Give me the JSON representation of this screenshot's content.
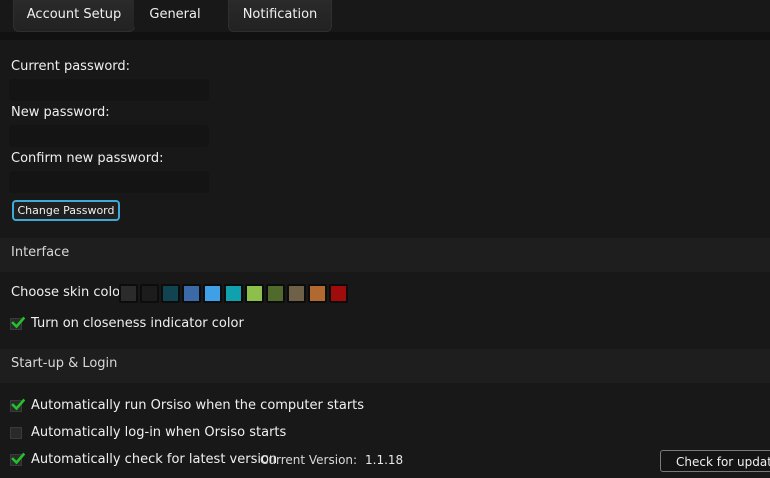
{
  "tabs": [
    {
      "label": "Account Setup",
      "active": false
    },
    {
      "label": "General",
      "active": true
    },
    {
      "label": "Notification",
      "active": false
    }
  ],
  "password": {
    "current_label": "Current password:",
    "current_value": "",
    "new_label": "New password:",
    "new_value": "",
    "confirm_label": "Confirm new password:",
    "confirm_value": "",
    "change_button": "Change Password"
  },
  "interface": {
    "section_title": "Interface",
    "skin_label": "Choose skin color:",
    "skin_colors": [
      "#2b2b2b",
      "#1c1c1c",
      "#0f4450",
      "#3c6aa8",
      "#3fa0e8",
      "#0fa1ad",
      "#8dc04a",
      "#4f6a2a",
      "#6f6048",
      "#b06a30",
      "#a00c0c"
    ],
    "closeness_label": "Turn on closeness indicator color",
    "closeness_checked": true
  },
  "startup": {
    "section_title": "Start-up & Login",
    "autorun_label": "Automatically run Orsiso when the computer starts",
    "autorun_checked": true,
    "autologin_label": "Automatically log-in when Orsiso starts",
    "autologin_checked": false,
    "autocheck_label": "Automatically check for latest version",
    "autocheck_checked": true,
    "version_label": "Current Version:",
    "version_value": "1.1.18",
    "update_button": "Check for updates"
  },
  "colors": {
    "accent": "#3fa9d8",
    "check": "#22c22a"
  }
}
